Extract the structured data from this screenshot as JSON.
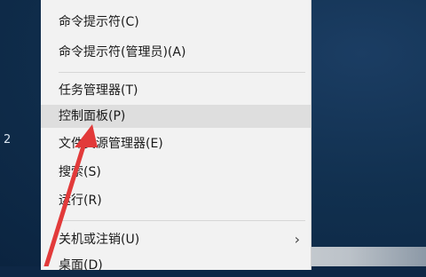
{
  "desktop": {
    "partial_text": "2"
  },
  "context_menu": {
    "items": [
      {
        "label": "命令提示符(C)"
      },
      {
        "label": "命令提示符(管理员)(A)"
      },
      {
        "label": "任务管理器(T)"
      },
      {
        "label": "控制面板(P)",
        "highlighted": true
      },
      {
        "label": "文件资源管理器(E)"
      },
      {
        "label": "搜索(S)"
      },
      {
        "label": "运行(R)"
      },
      {
        "label": "关机或注销(U)",
        "has_submenu": true
      },
      {
        "label": "桌面(D)"
      }
    ],
    "submenu_chevron": "›"
  },
  "annotation": {
    "arrow_color": "#e23a3a",
    "points_to": "控制面板(P)"
  }
}
